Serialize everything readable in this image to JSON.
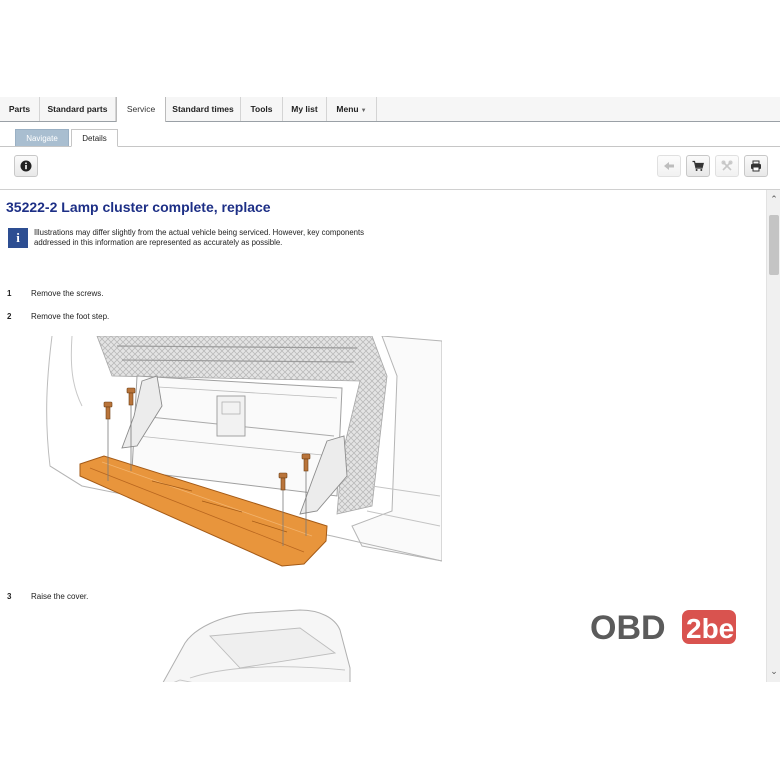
{
  "top_tabs": [
    {
      "label": "Parts"
    },
    {
      "label": "Standard parts"
    },
    {
      "label": "Service"
    },
    {
      "label": "Standard times"
    },
    {
      "label": "Tools"
    },
    {
      "label": "My list"
    },
    {
      "label": "Menu"
    }
  ],
  "active_top_tab": "Service",
  "sub_tabs": [
    {
      "label": "Navigate"
    },
    {
      "label": "Details"
    }
  ],
  "active_sub_tab": "Details",
  "toolbar": {
    "left_icons": [
      "info-icon"
    ],
    "right_icons": [
      "back-arrow-icon",
      "cart-icon",
      "tools-icon",
      "print-icon"
    ]
  },
  "document": {
    "title": "35222-2 Lamp cluster complete, replace",
    "info_text": "Illustrations may differ slightly from the actual vehicle being serviced. However, key components addressed in this information are represented as accurately as possible.",
    "steps": [
      {
        "num": "1",
        "text": "Remove the screws."
      },
      {
        "num": "2",
        "text": "Remove the foot step."
      },
      {
        "num": "3",
        "text": "Raise the cover."
      }
    ]
  },
  "colors": {
    "title": "#1d2f86",
    "info_icon_bg": "#2d4e92",
    "navigate_tab_bg": "#a9bed0",
    "highlight_part": "#e8953c"
  },
  "watermark": {
    "text1": "OBD",
    "text2": "2be"
  }
}
